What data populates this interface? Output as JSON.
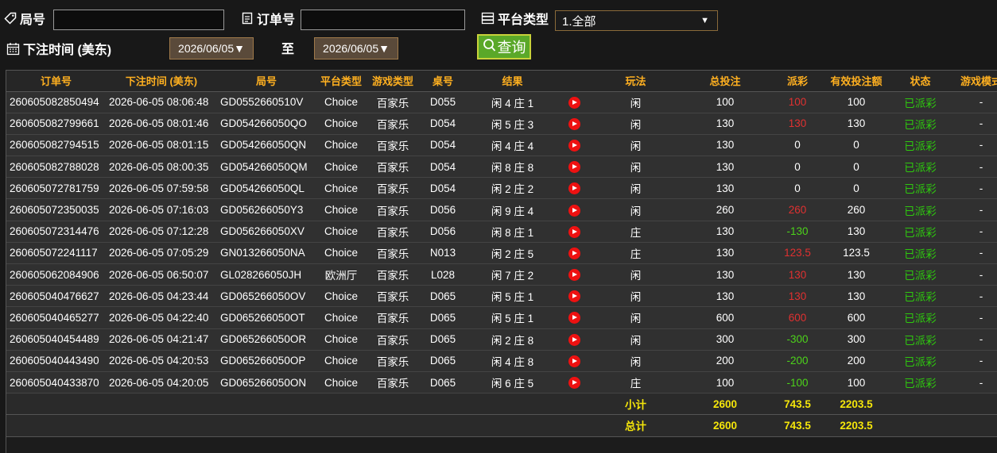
{
  "filters": {
    "round_label": "局号",
    "round_value": "",
    "order_label": "订单号",
    "order_value": "",
    "platform_label": "平台类型",
    "platform_selected": "1.全部",
    "bet_time_label": "下注时间 (美东)",
    "date_from": "2026/06/05▼",
    "to_label": "至",
    "date_to": "2026/06/05▼",
    "query_label": "查询"
  },
  "table": {
    "headers": [
      "订单号",
      "下注时间 (美东)",
      "局号",
      "平台类型",
      "游戏类型",
      "桌号",
      "结果",
      "",
      "玩法",
      "总投注",
      "派彩",
      "有效投注额",
      "状态",
      "游戏模式"
    ],
    "rows": [
      [
        "260605082850494",
        "2026-06-05 08:06:48",
        "GD0552660510V",
        "Choice",
        "百家乐",
        "D055",
        "闲 4 庄 1",
        "闲",
        "100",
        "100",
        "100",
        "已派彩",
        "-"
      ],
      [
        "260605082799661",
        "2026-06-05 08:01:46",
        "GD054266050QO",
        "Choice",
        "百家乐",
        "D054",
        "闲 5 庄 3",
        "闲",
        "130",
        "130",
        "130",
        "已派彩",
        "-"
      ],
      [
        "260605082794515",
        "2026-06-05 08:01:15",
        "GD054266050QN",
        "Choice",
        "百家乐",
        "D054",
        "闲 4 庄 4",
        "闲",
        "130",
        "0",
        "0",
        "已派彩",
        "-"
      ],
      [
        "260605082788028",
        "2026-06-05 08:00:35",
        "GD054266050QM",
        "Choice",
        "百家乐",
        "D054",
        "闲 8 庄 8",
        "闲",
        "130",
        "0",
        "0",
        "已派彩",
        "-"
      ],
      [
        "260605072781759",
        "2026-06-05 07:59:58",
        "GD054266050QL",
        "Choice",
        "百家乐",
        "D054",
        "闲 2 庄 2",
        "闲",
        "130",
        "0",
        "0",
        "已派彩",
        "-"
      ],
      [
        "260605072350035",
        "2026-06-05 07:16:03",
        "GD056266050Y3",
        "Choice",
        "百家乐",
        "D056",
        "闲 9 庄 4",
        "闲",
        "260",
        "260",
        "260",
        "已派彩",
        "-"
      ],
      [
        "260605072314476",
        "2026-06-05 07:12:28",
        "GD056266050XV",
        "Choice",
        "百家乐",
        "D056",
        "闲 8 庄 1",
        "庄",
        "130",
        "-130",
        "130",
        "已派彩",
        "-"
      ],
      [
        "260605072241117",
        "2026-06-05 07:05:29",
        "GN013266050NA",
        "Choice",
        "百家乐",
        "N013",
        "闲 2 庄 5",
        "庄",
        "130",
        "123.5",
        "123.5",
        "已派彩",
        "-"
      ],
      [
        "260605062084906",
        "2026-06-05 06:50:07",
        "GL028266050JH",
        "欧洲厅",
        "百家乐",
        "L028",
        "闲 7 庄 2",
        "闲",
        "130",
        "130",
        "130",
        "已派彩",
        "-"
      ],
      [
        "260605040476627",
        "2026-06-05 04:23:44",
        "GD065266050OV",
        "Choice",
        "百家乐",
        "D065",
        "闲 5 庄 1",
        "闲",
        "130",
        "130",
        "130",
        "已派彩",
        "-"
      ],
      [
        "260605040465277",
        "2026-06-05 04:22:40",
        "GD065266050OT",
        "Choice",
        "百家乐",
        "D065",
        "闲 5 庄 1",
        "闲",
        "600",
        "600",
        "600",
        "已派彩",
        "-"
      ],
      [
        "260605040454489",
        "2026-06-05 04:21:47",
        "GD065266050OR",
        "Choice",
        "百家乐",
        "D065",
        "闲 2 庄 8",
        "闲",
        "300",
        "-300",
        "300",
        "已派彩",
        "-"
      ],
      [
        "260605040443490",
        "2026-06-05 04:20:53",
        "GD065266050OP",
        "Choice",
        "百家乐",
        "D065",
        "闲 4 庄 8",
        "闲",
        "200",
        "-200",
        "200",
        "已派彩",
        "-"
      ],
      [
        "260605040433870",
        "2026-06-05 04:20:05",
        "GD065266050ON",
        "Choice",
        "百家乐",
        "D065",
        "闲 6 庄 5",
        "庄",
        "100",
        "-100",
        "100",
        "已派彩",
        "-"
      ]
    ],
    "subtotal": {
      "label": "小计",
      "total_bet": "2600",
      "payout": "743.5",
      "valid_bet": "2203.5"
    },
    "total": {
      "label": "总计",
      "total_bet": "2600",
      "payout": "743.5",
      "valid_bet": "2203.5"
    }
  },
  "colors": {
    "header_text": "#ffb020",
    "payout_positive": "#e03030",
    "payout_negative": "#4cd21a",
    "status_text": "#2ec90e",
    "summary_text": "#f5e60a",
    "query_button": "#5aa829"
  },
  "icons": {
    "round": "tag-icon",
    "order": "document-icon",
    "platform": "server-icon",
    "bet_time": "calendar-icon",
    "query": "search-icon",
    "replay": "play-icon"
  }
}
